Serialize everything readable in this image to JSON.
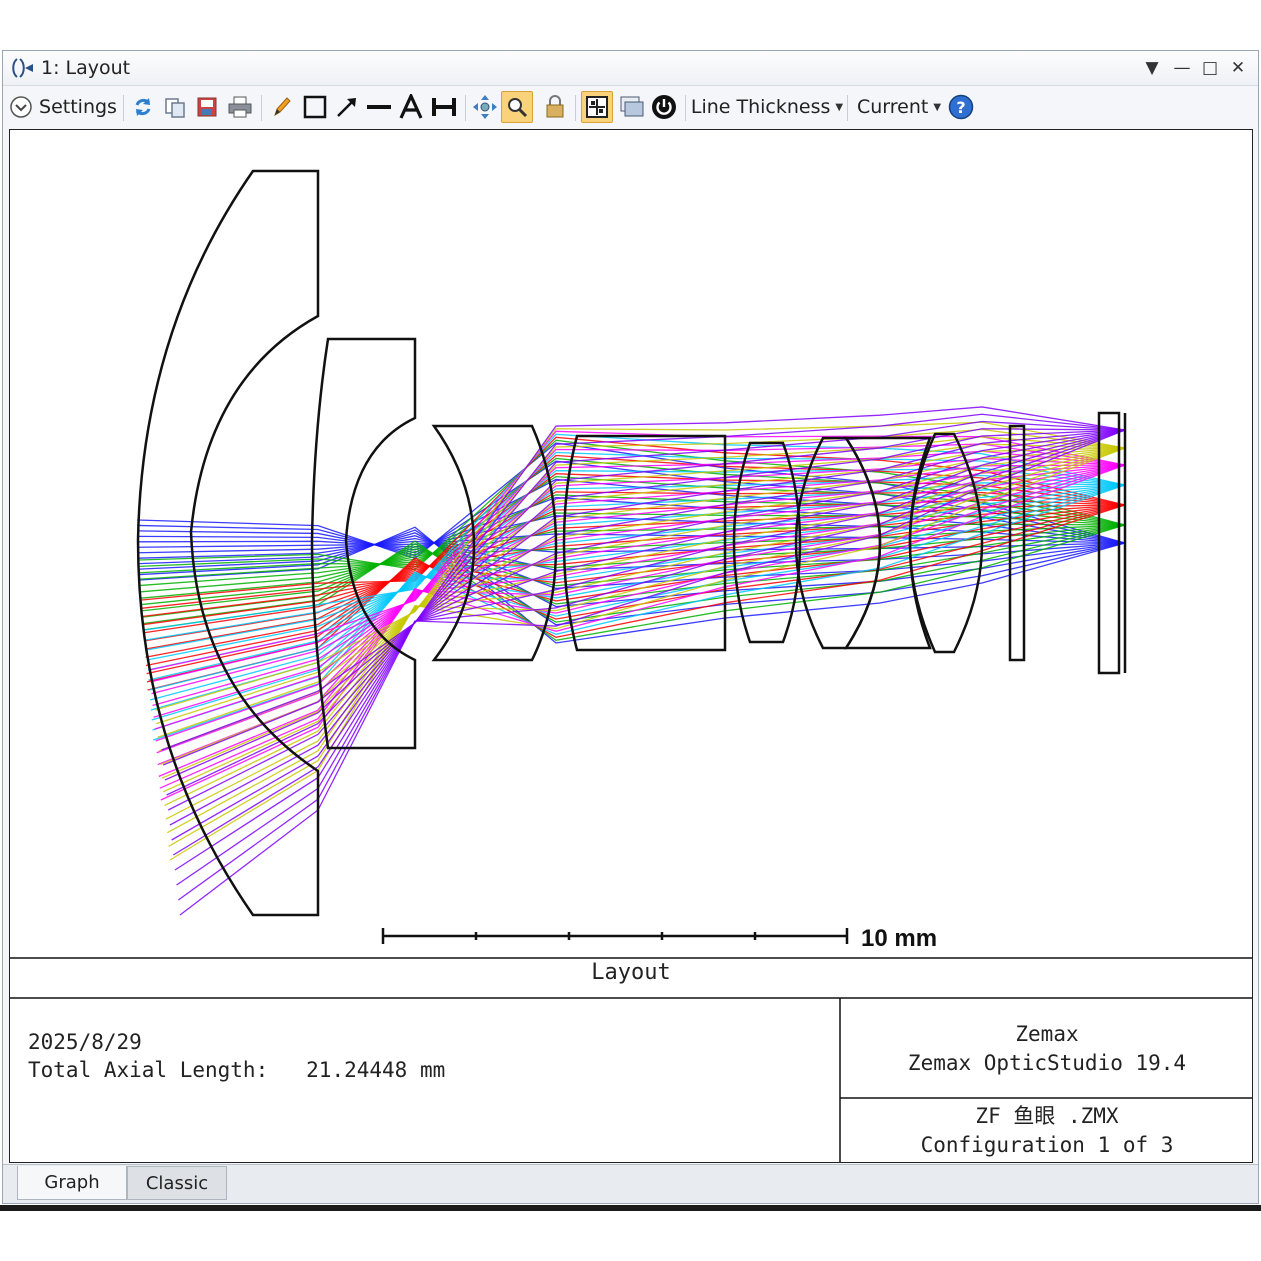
{
  "window": {
    "title": "1: Layout"
  },
  "toolbar": {
    "settings_label": "Settings",
    "line_thickness_label": "Line Thickness",
    "current_label": "Current"
  },
  "plot": {
    "scale_label": "10 mm",
    "caption_title": "Layout",
    "date": "2025/8/29",
    "axial_length_label": "Total Axial Length:",
    "axial_length_value": "21.24448 mm",
    "company": "Zemax",
    "product": "Zemax OpticStudio 19.4",
    "file_name": "ZF 鱼眼 .ZMX",
    "configuration": "Configuration 1 of 3"
  },
  "ray_colors": [
    "#1a1aff",
    "#00b000",
    "#ff0000",
    "#00c8ff",
    "#ff00ff",
    "#c8c800",
    "#8000ff",
    "#ff8000"
  ],
  "tabs": {
    "graph": "Graph",
    "classic": "Classic"
  }
}
